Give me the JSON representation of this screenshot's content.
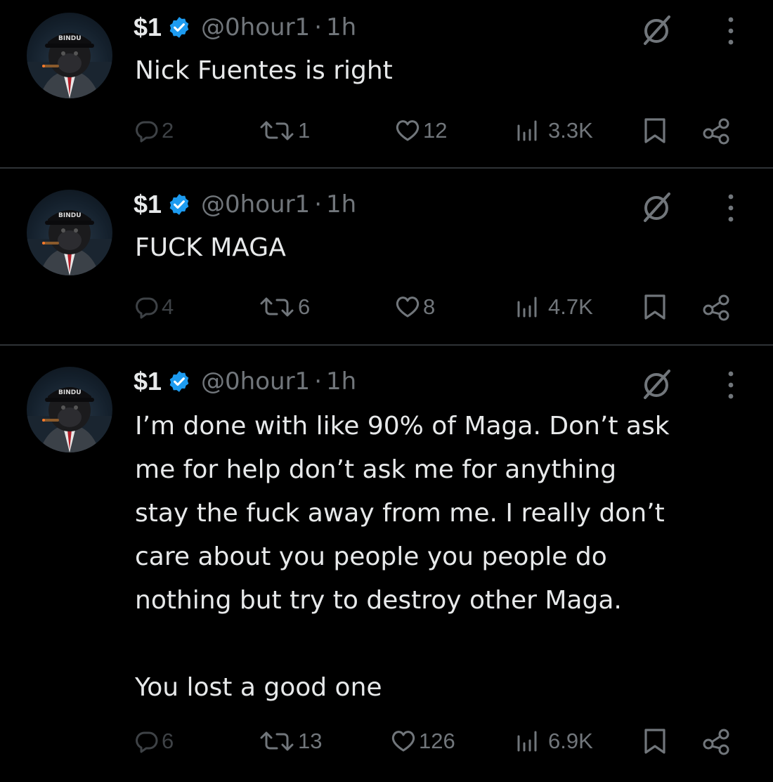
{
  "tweets": [
    {
      "name": "$1",
      "handle": "@0hour1",
      "separator": "·",
      "time": "1h",
      "text": "Nick Fuentes is right",
      "replies": "2",
      "reposts": "1",
      "likes": "12",
      "views": "3.3K"
    },
    {
      "name": "$1",
      "handle": "@0hour1",
      "separator": "·",
      "time": "1h",
      "text": "FUCK MAGA",
      "replies": "4",
      "reposts": "6",
      "likes": "8",
      "views": "4.7K"
    },
    {
      "name": "$1",
      "handle": "@0hour1",
      "separator": "·",
      "time": "1h",
      "text": "I’m done with like 90% of Maga. Don’t ask\nme for help don’t ask me for anything\nstay the fuck away from me. I really don’t\ncare about you people you people do\nnothing but try to destroy other Maga.\n\nYou lost a good one",
      "replies": "6",
      "reposts": "13",
      "likes": "126",
      "views": "6.9K"
    }
  ],
  "avatar": {
    "cap_text": "BINDU",
    "icon": "gorilla-avatar"
  },
  "colors": {
    "background": "#000000",
    "text": "#e7e9ea",
    "muted": "#71767b",
    "verified": "#1d9bf0",
    "divider": "#2f3336"
  }
}
